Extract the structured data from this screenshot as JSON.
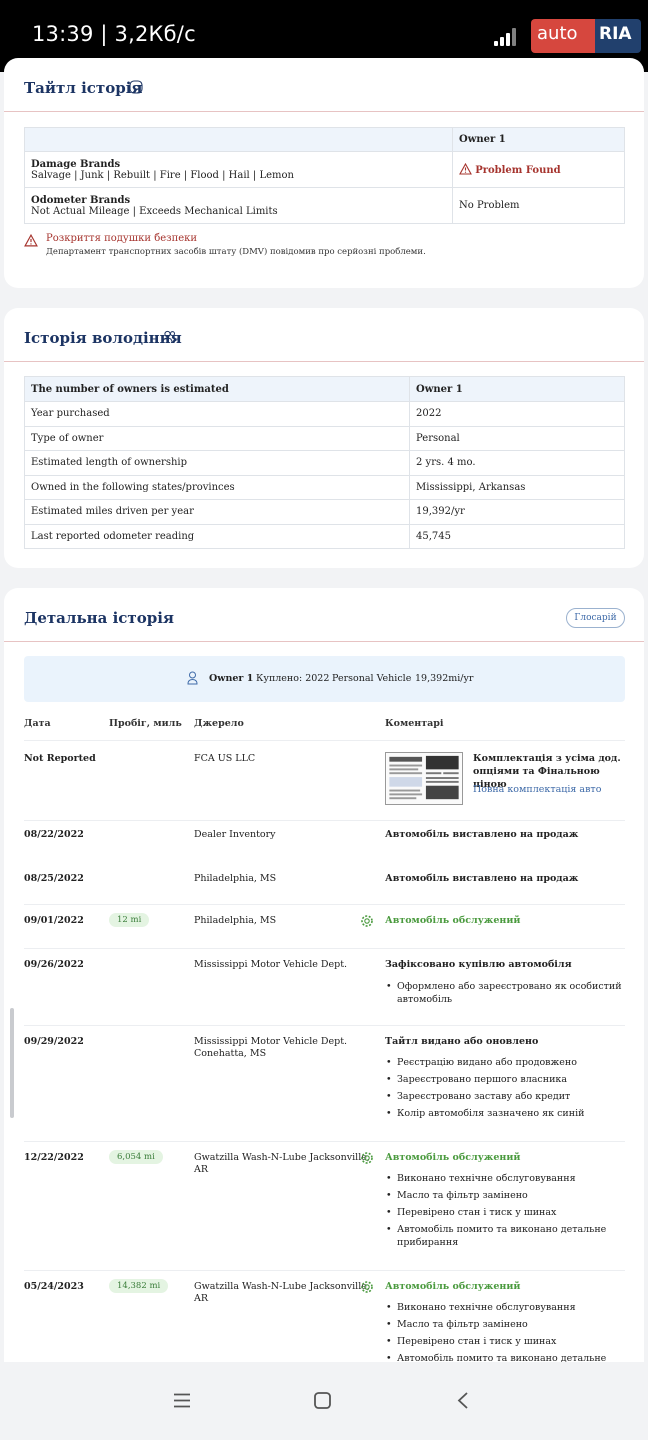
{
  "status": {
    "time": "13:39 | 3,2Кб/с",
    "brand_left": "auto",
    "brand_right": "RIA"
  },
  "title_history": {
    "title": "Тайтл історія",
    "col_owner": "Owner 1",
    "rows": [
      {
        "label": "Damage Brands",
        "detail": "Salvage | Junk | Rebuilt | Fire | Flood | Hail | Lemon",
        "value": "Problem Found"
      },
      {
        "label": "Odometer Brands",
        "detail": "Not Actual Mileage | Exceeds Mechanical Limits",
        "value": "No Problem"
      }
    ],
    "airbag_title": "Розкриття подушки безпеки",
    "airbag_text": "Департамент транспортних засобів штату (DMV) повідомив про серйозні проблеми."
  },
  "ownership": {
    "title": "Історія володіння",
    "header_label": "The number of owners is estimated",
    "header_owner": "Owner 1",
    "rows": [
      {
        "label": "Year purchased",
        "value": "2022"
      },
      {
        "label": "Type of owner",
        "value": "Personal"
      },
      {
        "label": "Estimated length of ownership",
        "value": "2 yrs. 4 mo."
      },
      {
        "label": "Owned in the following states/provinces",
        "value": "Mississippi, Arkansas"
      },
      {
        "label": "Estimated miles driven per year",
        "value": "19,392/yr"
      },
      {
        "label": "Last reported odometer reading",
        "value": "45,745"
      }
    ]
  },
  "detailed": {
    "title": "Детальна історія",
    "glossary": "Глосарій",
    "banner": {
      "owner": "Owner 1",
      "bought": "Куплено: 2022",
      "type": "Personal Vehicle",
      "miles": "19,392mi/yr"
    },
    "columns": {
      "date": "Дата",
      "mileage": "Пробіг, миль",
      "source": "Джерело",
      "comments": "Коментарі"
    },
    "rows": [
      {
        "date": "Not Reported",
        "mileage": "",
        "source": [
          "FCA US LLC"
        ],
        "comment": "Комплектація з усіма дод. опціями та Фінальною ціною",
        "link": "Повна комплектація авто",
        "bullets": []
      },
      {
        "date": "08/22/2022",
        "mileage": "",
        "source": [
          "Dealer Inventory"
        ],
        "comment": "Автомобіль виставлено на продаж",
        "bullets": []
      },
      {
        "date": "08/25/2022",
        "mileage": "",
        "source": [
          "Philadelphia, MS"
        ],
        "comment": "Автомобіль виставлено на продаж",
        "bullets": []
      },
      {
        "date": "09/01/2022",
        "mileage": "12 mi",
        "source": [
          "Philadelphia, MS"
        ],
        "comment": "Автомобіль обслужений",
        "bullets": []
      },
      {
        "date": "09/26/2022",
        "mileage": "",
        "source": [
          "Mississippi Motor Vehicle Dept."
        ],
        "comment": "Зафіксовано купівлю автомобіля",
        "bullets": [
          "Оформлено або зареєстровано як особистий",
          "автомобіль"
        ]
      },
      {
        "date": "09/29/2022",
        "mileage": "",
        "source": [
          "Mississippi Motor Vehicle Dept.",
          "Conehatta, MS"
        ],
        "comment": "Тайтл видано або оновлено",
        "bullets": [
          "Реєстрацію видано або продовжено",
          "Зареєстровано першого власника",
          "Зареєстровано заставу або кредит",
          "Колір автомобіля зазначено як синій"
        ]
      },
      {
        "date": "12/22/2022",
        "mileage": "6,054 mi",
        "source": [
          "Gwatzilla Wash-N-Lube Jacksonville,",
          "AR"
        ],
        "comment": "Автомобіль обслужений",
        "bullets": [
          "Виконано технічне обслуговування",
          "Масло та фільтр замінено",
          "Перевірено стан і тиск у шинах",
          "Автомобіль помито та виконано детальне",
          "прибирання"
        ]
      },
      {
        "date": "05/24/2023",
        "mileage": "14,382 mi",
        "source": [
          "Gwatzilla Wash-N-Lube Jacksonville,",
          "AR"
        ],
        "comment": "Автомобіль обслужений",
        "bullets": [
          "Виконано технічне обслуговування",
          "Масло та фільтр замінено",
          "Перевірено стан і тиск у шинах",
          "Автомобіль помито та виконано детальне"
        ]
      }
    ]
  },
  "colors": {
    "title": "#1c3463",
    "problem": "#a6342e",
    "service_green": "#4a9a3e",
    "rule": "#e7c3c3"
  }
}
